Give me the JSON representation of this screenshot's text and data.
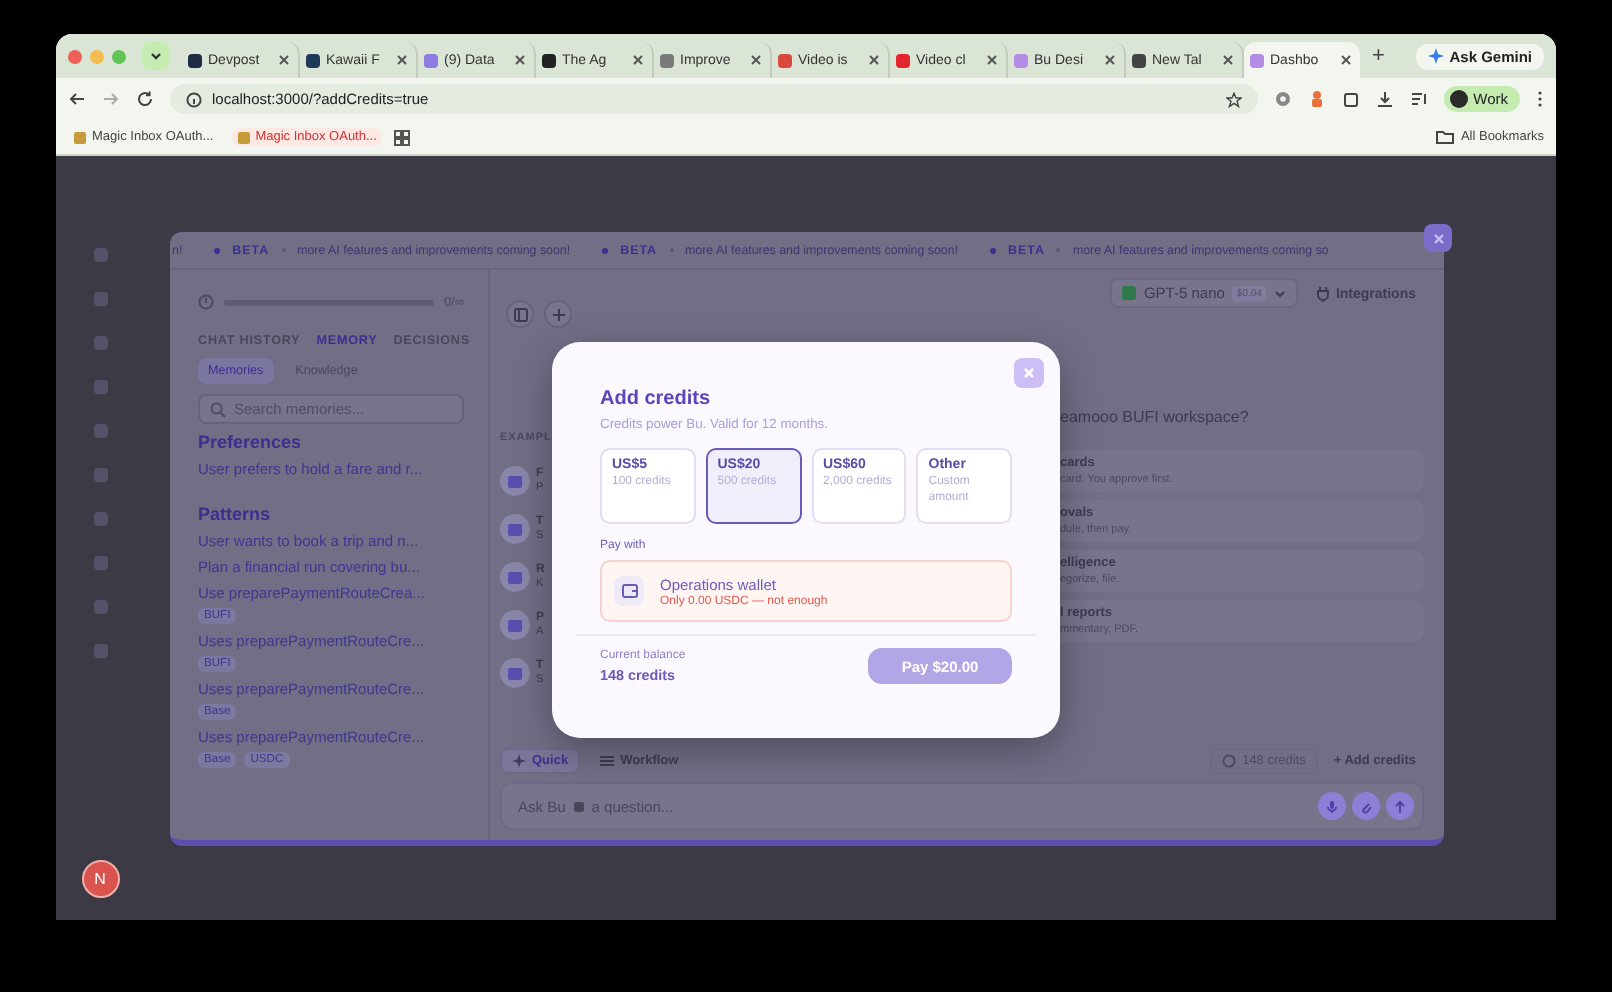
{
  "browser": {
    "tabs": [
      {
        "title": "Devpost",
        "color": "#1f2a44",
        "selected": false
      },
      {
        "title": "Kawaii F",
        "color": "#1f3b5c",
        "selected": false
      },
      {
        "title": "(9) Data",
        "color": "#8e7de0",
        "selected": false
      },
      {
        "title": "The Ag",
        "color": "#222222",
        "selected": false
      },
      {
        "title": "Improve",
        "color": "#7a7a7a",
        "selected": false
      },
      {
        "title": "Video is",
        "color": "#d9493b",
        "selected": false
      },
      {
        "title": "Video cl",
        "color": "#e3262c",
        "selected": false
      },
      {
        "title": "Bu Desi",
        "color": "#b48ce6",
        "selected": false
      },
      {
        "title": "New Tal",
        "color": "#444444",
        "selected": false
      },
      {
        "title": "Dashbo",
        "color": "#b48ce6",
        "selected": true
      }
    ],
    "new_tab": "+",
    "gemini": "Ask Gemini",
    "url": "localhost:3000/?addCredits=true",
    "profile": "Work",
    "bookmarks": [
      {
        "label": "Magic Inbox OAuth...",
        "highlighted": false
      },
      {
        "label": "Magic Inbox OAuth...",
        "highlighted": true
      }
    ],
    "all_bookmarks": "All Bookmarks"
  },
  "rail": {
    "avatar": "N"
  },
  "app": {
    "banner": {
      "lead": "n!",
      "items": [
        {
          "badge": "BETA",
          "text": "more AI features and improvements coming soon!"
        },
        {
          "badge": "BETA",
          "text": "more AI features and improvements coming soon!"
        },
        {
          "badge": "BETA",
          "text": "more AI features and improvements coming so"
        }
      ]
    },
    "memory": {
      "usage": {
        "level": 0,
        "label": "0/∞"
      },
      "tabs": [
        {
          "label": "CHAT HISTORY",
          "selected": false
        },
        {
          "label": "MEMORY",
          "selected": true
        },
        {
          "label": "DECISIONS",
          "selected": false
        }
      ],
      "subtabs": [
        {
          "label": "Memories",
          "selected": true
        },
        {
          "label": "Knowledge",
          "selected": false
        }
      ],
      "search": {
        "placeholder": "Search memories..."
      },
      "sections": [
        {
          "title": "Preferences",
          "items": [
            {
              "text": "User prefers to hold a fare and r..."
            }
          ]
        },
        {
          "title": "Patterns",
          "items": [
            {
              "text": "User wants to book a trip and n..."
            },
            {
              "text": "Plan a financial run covering bu..."
            },
            {
              "text": "Use preparePaymentRouteCrea...",
              "tags": [
                "BUFI"
              ]
            },
            {
              "text": "Uses preparePaymentRouteCre...",
              "tags": [
                "BUFI"
              ]
            },
            {
              "text": "Uses preparePaymentRouteCre...",
              "tags": [
                "Base"
              ]
            },
            {
              "text": "Uses preparePaymentRouteCre...",
              "tags": [
                "Base",
                "USDC"
              ]
            }
          ]
        }
      ]
    },
    "chat": {
      "model": {
        "name": "GPT-5 nano",
        "price": "$0.04"
      },
      "integrations": "Integrations",
      "greeting_fragment": "eamooo BUFI workspace?",
      "examples_heading": "EXAMPL",
      "example_stubs": [
        {
          "title": "F",
          "subtitle": "P"
        },
        {
          "title": "T",
          "subtitle": "S"
        },
        {
          "title": "R",
          "subtitle": "K"
        },
        {
          "title": "P",
          "subtitle": "A"
        },
        {
          "title": "T",
          "subtitle": "S"
        }
      ],
      "example_cards": [
        {
          "title": "cards",
          "subtitle": "card. You approve first."
        },
        {
          "title": "ovals",
          "subtitle": "dule, then pay."
        },
        {
          "title": "elligence",
          "subtitle": "egorize, file."
        },
        {
          "title": "l reports",
          "subtitle": "mmentary, PDF."
        }
      ],
      "modes": [
        {
          "label": "Quick",
          "selected": true
        },
        {
          "label": "Workflow",
          "selected": false
        }
      ],
      "credits": "148 credits",
      "add_credits": "+ Add credits",
      "input": {
        "placeholder_start": "Ask Bu",
        "placeholder_end": "a question..."
      }
    }
  },
  "modal": {
    "title": "Add credits",
    "subtitle": "Credits power Bu. Valid for 12 months.",
    "options": [
      {
        "price": "US$5",
        "credits": "100 credits",
        "selected": false
      },
      {
        "price": "US$20",
        "credits": "500 credits",
        "selected": true
      },
      {
        "price": "US$60",
        "credits": "2,000 credits",
        "selected": false
      },
      {
        "price": "Other",
        "credits": "Custom amount",
        "selected": false
      }
    ],
    "pay_with_label": "Pay with",
    "wallet": {
      "name": "Operations wallet",
      "status": "Only 0.00 USDC — not enough"
    },
    "balance_label": "Current balance",
    "balance": "148 credits",
    "pay_button": "Pay $20.00"
  }
}
